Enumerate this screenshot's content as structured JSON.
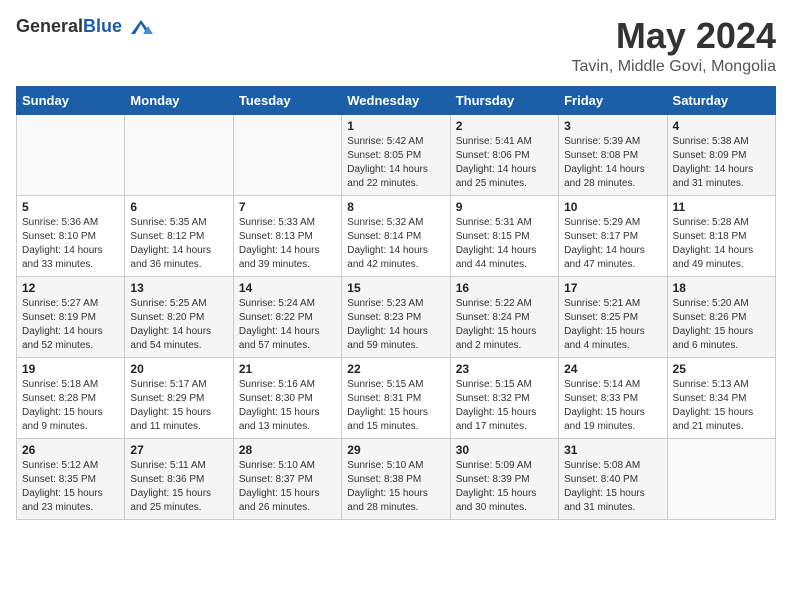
{
  "header": {
    "logo_general": "General",
    "logo_blue": "Blue",
    "month_year": "May 2024",
    "location": "Tavin, Middle Govi, Mongolia"
  },
  "weekdays": [
    "Sunday",
    "Monday",
    "Tuesday",
    "Wednesday",
    "Thursday",
    "Friday",
    "Saturday"
  ],
  "weeks": [
    [
      {
        "day": "",
        "info": ""
      },
      {
        "day": "",
        "info": ""
      },
      {
        "day": "",
        "info": ""
      },
      {
        "day": "1",
        "info": "Sunrise: 5:42 AM\nSunset: 8:05 PM\nDaylight: 14 hours\nand 22 minutes."
      },
      {
        "day": "2",
        "info": "Sunrise: 5:41 AM\nSunset: 8:06 PM\nDaylight: 14 hours\nand 25 minutes."
      },
      {
        "day": "3",
        "info": "Sunrise: 5:39 AM\nSunset: 8:08 PM\nDaylight: 14 hours\nand 28 minutes."
      },
      {
        "day": "4",
        "info": "Sunrise: 5:38 AM\nSunset: 8:09 PM\nDaylight: 14 hours\nand 31 minutes."
      }
    ],
    [
      {
        "day": "5",
        "info": "Sunrise: 5:36 AM\nSunset: 8:10 PM\nDaylight: 14 hours\nand 33 minutes."
      },
      {
        "day": "6",
        "info": "Sunrise: 5:35 AM\nSunset: 8:12 PM\nDaylight: 14 hours\nand 36 minutes."
      },
      {
        "day": "7",
        "info": "Sunrise: 5:33 AM\nSunset: 8:13 PM\nDaylight: 14 hours\nand 39 minutes."
      },
      {
        "day": "8",
        "info": "Sunrise: 5:32 AM\nSunset: 8:14 PM\nDaylight: 14 hours\nand 42 minutes."
      },
      {
        "day": "9",
        "info": "Sunrise: 5:31 AM\nSunset: 8:15 PM\nDaylight: 14 hours\nand 44 minutes."
      },
      {
        "day": "10",
        "info": "Sunrise: 5:29 AM\nSunset: 8:17 PM\nDaylight: 14 hours\nand 47 minutes."
      },
      {
        "day": "11",
        "info": "Sunrise: 5:28 AM\nSunset: 8:18 PM\nDaylight: 14 hours\nand 49 minutes."
      }
    ],
    [
      {
        "day": "12",
        "info": "Sunrise: 5:27 AM\nSunset: 8:19 PM\nDaylight: 14 hours\nand 52 minutes."
      },
      {
        "day": "13",
        "info": "Sunrise: 5:25 AM\nSunset: 8:20 PM\nDaylight: 14 hours\nand 54 minutes."
      },
      {
        "day": "14",
        "info": "Sunrise: 5:24 AM\nSunset: 8:22 PM\nDaylight: 14 hours\nand 57 minutes."
      },
      {
        "day": "15",
        "info": "Sunrise: 5:23 AM\nSunset: 8:23 PM\nDaylight: 14 hours\nand 59 minutes."
      },
      {
        "day": "16",
        "info": "Sunrise: 5:22 AM\nSunset: 8:24 PM\nDaylight: 15 hours\nand 2 minutes."
      },
      {
        "day": "17",
        "info": "Sunrise: 5:21 AM\nSunset: 8:25 PM\nDaylight: 15 hours\nand 4 minutes."
      },
      {
        "day": "18",
        "info": "Sunrise: 5:20 AM\nSunset: 8:26 PM\nDaylight: 15 hours\nand 6 minutes."
      }
    ],
    [
      {
        "day": "19",
        "info": "Sunrise: 5:18 AM\nSunset: 8:28 PM\nDaylight: 15 hours\nand 9 minutes."
      },
      {
        "day": "20",
        "info": "Sunrise: 5:17 AM\nSunset: 8:29 PM\nDaylight: 15 hours\nand 11 minutes."
      },
      {
        "day": "21",
        "info": "Sunrise: 5:16 AM\nSunset: 8:30 PM\nDaylight: 15 hours\nand 13 minutes."
      },
      {
        "day": "22",
        "info": "Sunrise: 5:15 AM\nSunset: 8:31 PM\nDaylight: 15 hours\nand 15 minutes."
      },
      {
        "day": "23",
        "info": "Sunrise: 5:15 AM\nSunset: 8:32 PM\nDaylight: 15 hours\nand 17 minutes."
      },
      {
        "day": "24",
        "info": "Sunrise: 5:14 AM\nSunset: 8:33 PM\nDaylight: 15 hours\nand 19 minutes."
      },
      {
        "day": "25",
        "info": "Sunrise: 5:13 AM\nSunset: 8:34 PM\nDaylight: 15 hours\nand 21 minutes."
      }
    ],
    [
      {
        "day": "26",
        "info": "Sunrise: 5:12 AM\nSunset: 8:35 PM\nDaylight: 15 hours\nand 23 minutes."
      },
      {
        "day": "27",
        "info": "Sunrise: 5:11 AM\nSunset: 8:36 PM\nDaylight: 15 hours\nand 25 minutes."
      },
      {
        "day": "28",
        "info": "Sunrise: 5:10 AM\nSunset: 8:37 PM\nDaylight: 15 hours\nand 26 minutes."
      },
      {
        "day": "29",
        "info": "Sunrise: 5:10 AM\nSunset: 8:38 PM\nDaylight: 15 hours\nand 28 minutes."
      },
      {
        "day": "30",
        "info": "Sunrise: 5:09 AM\nSunset: 8:39 PM\nDaylight: 15 hours\nand 30 minutes."
      },
      {
        "day": "31",
        "info": "Sunrise: 5:08 AM\nSunset: 8:40 PM\nDaylight: 15 hours\nand 31 minutes."
      },
      {
        "day": "",
        "info": ""
      }
    ]
  ]
}
